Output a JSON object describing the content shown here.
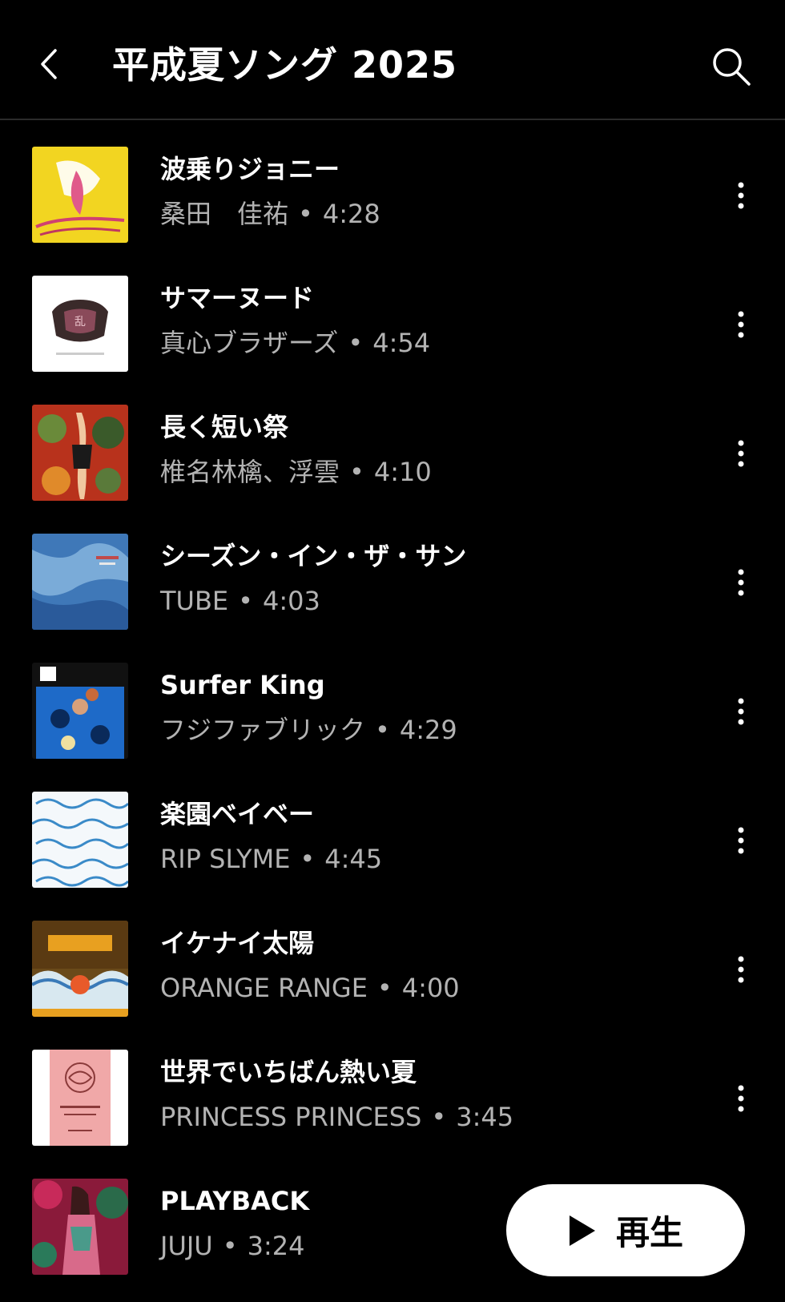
{
  "header": {
    "title": "平成夏ソング 2025",
    "back_icon": "chevron-left-icon",
    "search_icon": "search-icon"
  },
  "tracks": [
    {
      "title": "波乗りジョニー",
      "artist": "桑田　佳祐",
      "duration": "4:28"
    },
    {
      "title": "サマーヌード",
      "artist": "真心ブラザーズ",
      "duration": "4:54"
    },
    {
      "title": "長く短い祭",
      "artist": "椎名林檎、浮雲",
      "duration": "4:10"
    },
    {
      "title": "シーズン・イン・ザ・サン",
      "artist": "TUBE",
      "duration": "4:03"
    },
    {
      "title": "Surfer King",
      "artist": "フジファブリック",
      "duration": "4:29"
    },
    {
      "title": "楽園ベイベー",
      "artist": "RIP SLYME",
      "duration": "4:45"
    },
    {
      "title": "イケナイ太陽",
      "artist": "ORANGE RANGE",
      "duration": "4:00"
    },
    {
      "title": "世界でいちばん熱い夏",
      "artist": "PRINCESS PRINCESS",
      "duration": "3:45"
    },
    {
      "title": "PLAYBACK",
      "artist": "JUJU",
      "duration": "3:24"
    }
  ],
  "separator": "•",
  "play_button": {
    "label": "再生",
    "icon": "play-icon"
  },
  "colors": {
    "background": "#000000",
    "text": "#ffffff",
    "subtext": "#b3b3b3",
    "button": "#ffffff"
  }
}
